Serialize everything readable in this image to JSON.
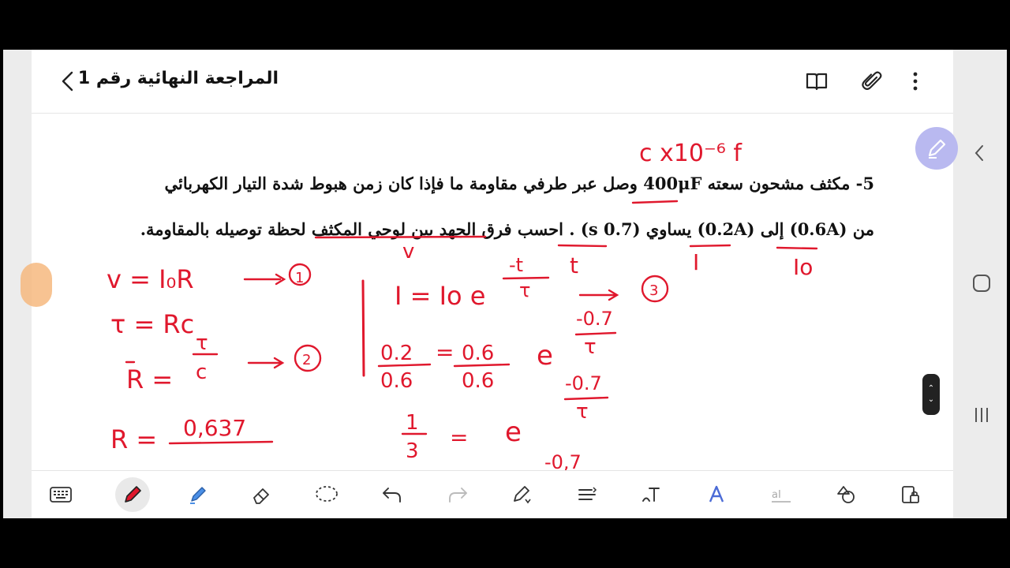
{
  "title": "المراجعة النهائية رقم 1",
  "question": {
    "line1": "5- مكثف مشحون سعته 400μF وصل عبر طرفي مقاومة ما فإذا كان زمن هبوط شدة التيار الكهربائي",
    "line2": "من (0.6A) إلى (0.2A) يساوي (0.7 s) . احسب فرق الجهد بين لوحي المكثف لحظة توصيله بالمقاومة."
  },
  "handwriting": {
    "cap_note": "c x10⁻⁶ f",
    "mark_v": "v",
    "mark_t": "t",
    "mark_I": "I",
    "mark_I0": "Io",
    "eq1": "v = I₀R",
    "eq1_num": "1",
    "eq2": "τ = Rc",
    "eq3_lhs": "R =",
    "eq3_num": "τ",
    "eq3_den": "c",
    "eq3_ref": "2",
    "eq4_lhs": "R =",
    "eq4_num": "0,637",
    "eq5_lhs": "I = Io e",
    "eq5_exp_num": "-t",
    "eq5_exp_den": "τ",
    "eq5_ref": "3",
    "eq6_lhs_num": "0.2",
    "eq6_lhs_den": "0.6",
    "eq6_mid_num": "0.6",
    "eq6_mid_den": "0.6",
    "eq6_e": "e",
    "eq6_exp_num": "-0.7",
    "eq6_exp_den": "τ",
    "eq7_lhs_num": "1",
    "eq7_lhs_den": "3",
    "eq7_eq": "=",
    "eq7_e": "e",
    "eq7_exp_num": "-0.7",
    "eq7_exp_den": "τ",
    "eq8_partial": "-0,7"
  },
  "colors": {
    "ink": "#e0182d",
    "fab": "#b9b9f0",
    "accent": "#4b6bd6",
    "text": "#111111"
  },
  "toolbar": [
    "keyboard-icon",
    "pen-icon",
    "highlighter-icon",
    "eraser-icon",
    "lasso-icon",
    "undo-icon",
    "redo-icon",
    "pen-settings-icon",
    "text-align-icon",
    "text-tool-icon",
    "text-style-icon",
    "text-format-icon",
    "shapes-icon",
    "lock-icon"
  ]
}
